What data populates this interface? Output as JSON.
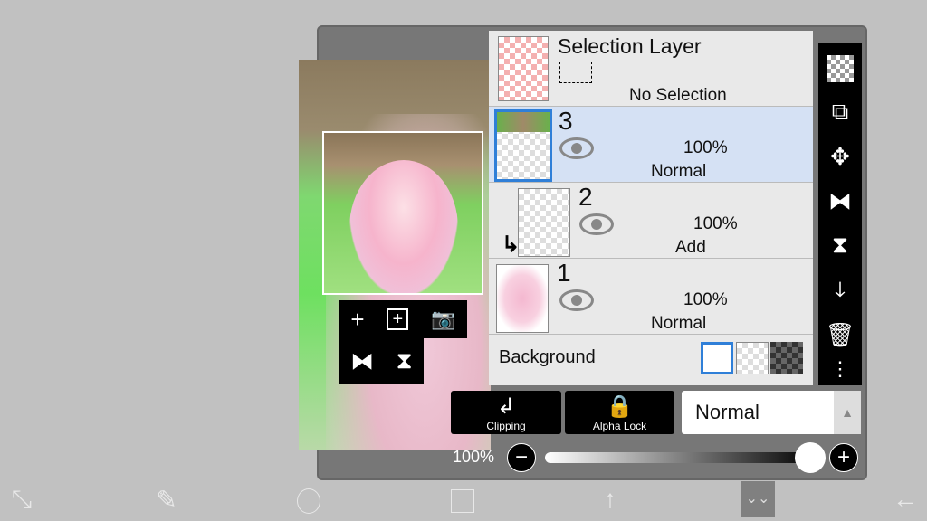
{
  "layers": {
    "selection": {
      "name": "Selection Layer",
      "status": "No Selection"
    },
    "items": [
      {
        "number": "3",
        "opacity": "100%",
        "mode": "Normal",
        "selected": true
      },
      {
        "number": "2",
        "opacity": "100%",
        "mode": "Add",
        "clipped": true
      },
      {
        "number": "1",
        "opacity": "100%",
        "mode": "Normal"
      }
    ],
    "background": {
      "label": "Background"
    }
  },
  "buttons": {
    "clipping": "Clipping",
    "alpha_lock": "Alpha Lock",
    "blend_mode": "Normal"
  },
  "opacity": {
    "label": "100%",
    "value": 100
  },
  "tools": [
    "checker-icon",
    "swap-layer-icon",
    "move-icon",
    "flip-horizontal-icon",
    "flip-vertical-icon",
    "merge-down-icon",
    "trash-icon",
    "more-icon"
  ],
  "accent": "#2f7fd8"
}
